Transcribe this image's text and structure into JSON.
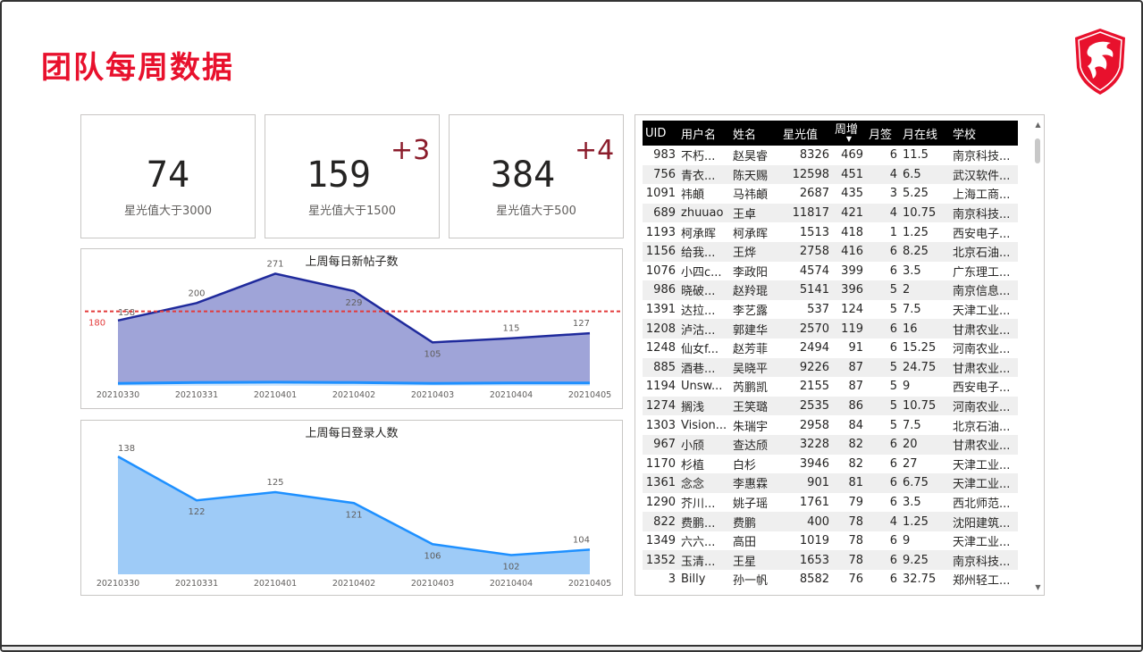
{
  "page": {
    "title": "团队每周数据"
  },
  "logo": {
    "icon": "msi-dragon-shield-icon",
    "color": "#e8112d"
  },
  "cards": [
    {
      "value": "74",
      "label": "星光值大于3000",
      "delta": ""
    },
    {
      "value": "159",
      "label": "星光值大于1500",
      "delta": "+3"
    },
    {
      "value": "384",
      "label": "星光值大于500",
      "delta": "+4"
    }
  ],
  "chart_data": [
    {
      "type": "area",
      "title": "上周每日新帖子数",
      "categories": [
        "20210330",
        "20210331",
        "20210401",
        "20210402",
        "20210403",
        "20210404",
        "20210405"
      ],
      "series": [
        {
          "values": [
            158,
            200,
            271,
            229,
            105,
            115,
            127
          ],
          "color": "#9fa4d8",
          "line_color": "#1f2a9c"
        },
        {
          "values": [
            6,
            8,
            9,
            8,
            6,
            7,
            7
          ],
          "color": "#d0e6fb",
          "line_color": "#1e90ff"
        }
      ],
      "reference_line": {
        "value": 180,
        "label": "180",
        "color": "#e33b3b",
        "style": "dashed"
      },
      "ylim": [
        0,
        300
      ],
      "grid": false
    },
    {
      "type": "area",
      "title": "上周每日登录人数",
      "categories": [
        "20210330",
        "20210331",
        "20210401",
        "20210402",
        "20210403",
        "20210404",
        "20210405"
      ],
      "series": [
        {
          "values": [
            138,
            122,
            125,
            121,
            106,
            102,
            104
          ],
          "color": "#9ecbf7",
          "line_color": "#1e90ff"
        }
      ],
      "ylim": [
        95,
        140
      ],
      "grid": false
    }
  ],
  "table": {
    "columns": [
      "UID",
      "用户名",
      "姓名",
      "星光值",
      "周增",
      "月签",
      "月在线",
      "学校"
    ],
    "sort_indicator": "▼",
    "rows": [
      [
        "983",
        "不朽...",
        "赵昊睿",
        "8326",
        "469",
        "6",
        "11.5",
        "南京科技..."
      ],
      [
        "756",
        "青衣...",
        "陈天赐",
        "12598",
        "451",
        "4",
        "6.5",
        "武汉软件..."
      ],
      [
        "1091",
        "祎頔",
        "马祎頔",
        "2687",
        "435",
        "3",
        "5.25",
        "上海工商..."
      ],
      [
        "689",
        "zhuuao",
        "王卓",
        "11817",
        "421",
        "4",
        "10.75",
        "南京科技..."
      ],
      [
        "1193",
        "柯承晖",
        "柯承晖",
        "1513",
        "418",
        "1",
        "1.25",
        "西安电子..."
      ],
      [
        "1156",
        "给我...",
        "王烨",
        "2758",
        "416",
        "6",
        "8.25",
        "北京石油..."
      ],
      [
        "1076",
        "小四c...",
        "李政阳",
        "4574",
        "399",
        "6",
        "3.5",
        "广东理工..."
      ],
      [
        "986",
        "晓破...",
        "赵羚琨",
        "5141",
        "396",
        "5",
        "2",
        "南京信息..."
      ],
      [
        "1391",
        "达拉...",
        "李艺露",
        "537",
        "124",
        "5",
        "7.5",
        "天津工业..."
      ],
      [
        "1208",
        "泸沽...",
        "郭建华",
        "2570",
        "119",
        "6",
        "16",
        "甘肃农业..."
      ],
      [
        "1248",
        "仙女f...",
        "赵芳菲",
        "2494",
        "91",
        "6",
        "15.25",
        "河南农业..."
      ],
      [
        "885",
        "酒巷...",
        "吴晓平",
        "9226",
        "87",
        "5",
        "24.75",
        "甘肃农业..."
      ],
      [
        "1194",
        "Unsw...",
        "芮鹏凯",
        "2155",
        "87",
        "5",
        "9",
        "西安电子..."
      ],
      [
        "1274",
        "搁浅",
        "王笑璐",
        "2535",
        "86",
        "5",
        "10.75",
        "河南农业..."
      ],
      [
        "1303",
        "Vision...",
        "朱瑞宇",
        "2958",
        "84",
        "5",
        "7.5",
        "北京石油..."
      ],
      [
        "967",
        "小颀",
        "查达颀",
        "3228",
        "82",
        "6",
        "20",
        "甘肃农业..."
      ],
      [
        "1170",
        "杉植",
        "白杉",
        "3946",
        "82",
        "6",
        "27",
        "天津工业..."
      ],
      [
        "1361",
        "念念",
        "李惠霖",
        "901",
        "81",
        "6",
        "6.75",
        "天津工业..."
      ],
      [
        "1290",
        "芥川...",
        "姚子瑶",
        "1761",
        "79",
        "6",
        "3.5",
        "西北师范..."
      ],
      [
        "822",
        "费鹏...",
        "费鹏",
        "400",
        "78",
        "4",
        "1.25",
        "沈阳建筑..."
      ],
      [
        "1349",
        "六六...",
        "高田",
        "1019",
        "78",
        "6",
        "9",
        "天津工业..."
      ],
      [
        "1352",
        "玉清...",
        "王星",
        "1653",
        "78",
        "6",
        "9.25",
        "南京科技..."
      ],
      [
        "3",
        "Billy",
        "孙一帆",
        "8582",
        "76",
        "6",
        "32.75",
        "郑州轻工..."
      ]
    ]
  }
}
